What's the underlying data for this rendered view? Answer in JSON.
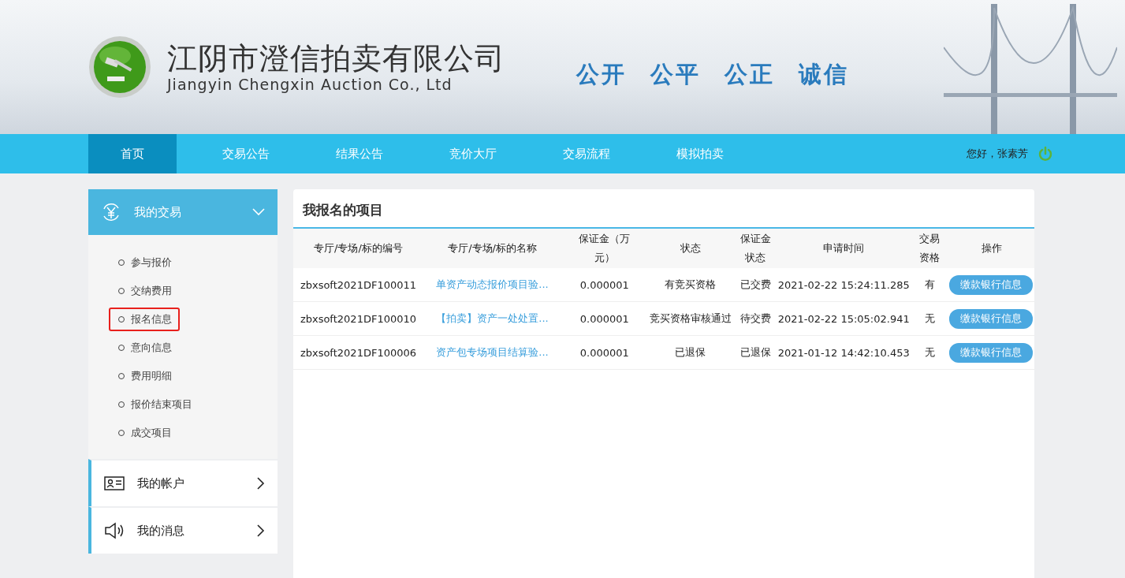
{
  "header": {
    "company_name": "江阴市澄信拍卖有限公司",
    "company_name_en": "Jiangyin Chengxin Auction Co., Ltd",
    "slogan": [
      "公开",
      "公平",
      "公正",
      "诚信"
    ]
  },
  "nav": {
    "items": [
      {
        "label": "首页",
        "selected": true
      },
      {
        "label": "交易公告",
        "selected": false
      },
      {
        "label": "结果公告",
        "selected": false
      },
      {
        "label": "竞价大厅",
        "selected": false
      },
      {
        "label": "交易流程",
        "selected": false
      },
      {
        "label": "模拟拍卖",
        "selected": false
      }
    ],
    "greeting": "您好，张素芳"
  },
  "sidebar": {
    "sections": [
      {
        "kind": "trade",
        "title": "我的交易",
        "expanded": true,
        "items": [
          {
            "label": "参与报价",
            "selected": false
          },
          {
            "label": "交纳费用",
            "selected": false
          },
          {
            "label": "报名信息",
            "selected": true
          },
          {
            "label": "意向信息",
            "selected": false
          },
          {
            "label": "费用明细",
            "selected": false
          },
          {
            "label": "报价结束项目",
            "selected": false
          },
          {
            "label": "成交项目",
            "selected": false
          }
        ]
      },
      {
        "kind": "account",
        "title": "我的帐户",
        "expanded": false
      },
      {
        "kind": "message",
        "title": "我的消息",
        "expanded": false
      }
    ]
  },
  "panel": {
    "title": "我报名的项目",
    "table": {
      "columns": [
        "专厅/专场/标的编号",
        "专厅/专场/标的名称",
        "保证金（万元）",
        "状态",
        "保证金状态",
        "申请时间",
        "交易资格",
        "操作"
      ],
      "rows": [
        {
          "code": "zbxsoft2021DF100011",
          "name": "单资产动态报价项目验...",
          "deposit": "0.000001",
          "status": "有竞买资格",
          "deposit_status": "已交费",
          "time": "2021-02-22 15:24:11.285",
          "eligible": "有",
          "action": "缴款银行信息"
        },
        {
          "code": "zbxsoft2021DF100010",
          "name": "【拍卖】资产一处处置...",
          "deposit": "0.000001",
          "status": "竞买资格审核通过",
          "deposit_status": "待交费",
          "time": "2021-02-22 15:05:02.941",
          "eligible": "无",
          "action": "缴款银行信息"
        },
        {
          "code": "zbxsoft2021DF100006",
          "name": "资产包专场项目结算验...",
          "deposit": "0.000001",
          "status": "已退保",
          "deposit_status": "已退保",
          "time": "2021-01-12 14:42:10.453",
          "eligible": "无",
          "action": "缴款银行信息"
        }
      ]
    }
  }
}
